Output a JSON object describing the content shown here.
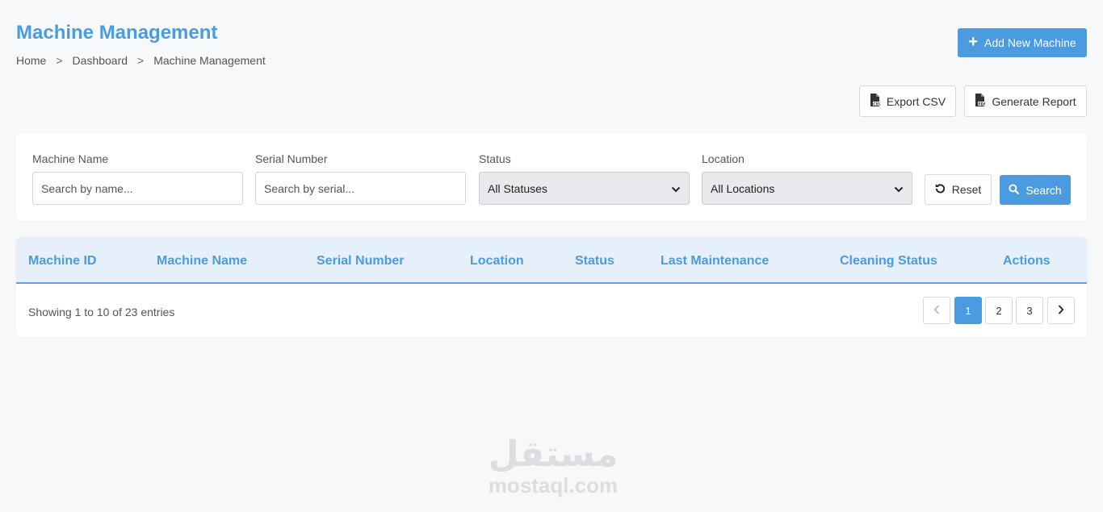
{
  "header": {
    "title": "Machine Management",
    "breadcrumb": [
      "Home",
      "Dashboard",
      "Machine Management"
    ],
    "breadcrumb_separator": ">",
    "add_button_label": "Add New Machine"
  },
  "toolbar": {
    "export_label": "Export CSV",
    "report_label": "Generate Report"
  },
  "filters": {
    "machine_name": {
      "label": "Machine Name",
      "placeholder": "Search by name..."
    },
    "serial_number": {
      "label": "Serial Number",
      "placeholder": "Search by serial..."
    },
    "status": {
      "label": "Status",
      "selected": "All Statuses"
    },
    "location": {
      "label": "Location",
      "selected": "All Locations"
    },
    "reset_label": "Reset",
    "search_label": "Search"
  },
  "table": {
    "columns": [
      "Machine ID",
      "Machine Name",
      "Serial Number",
      "Location",
      "Status",
      "Last Maintenance",
      "Cleaning Status",
      "Actions"
    ],
    "rows": [],
    "showing_text": "Showing 1 to 10 of 23 entries"
  },
  "pagination": {
    "pages": [
      "1",
      "2",
      "3"
    ],
    "current": "1"
  },
  "watermark": {
    "logo_text": "مستقل",
    "url": "mostaql.com"
  },
  "colors": {
    "accent": "#4a9be0",
    "header_bg": "#e6f0fa",
    "page_bg": "#f7f8fa"
  }
}
